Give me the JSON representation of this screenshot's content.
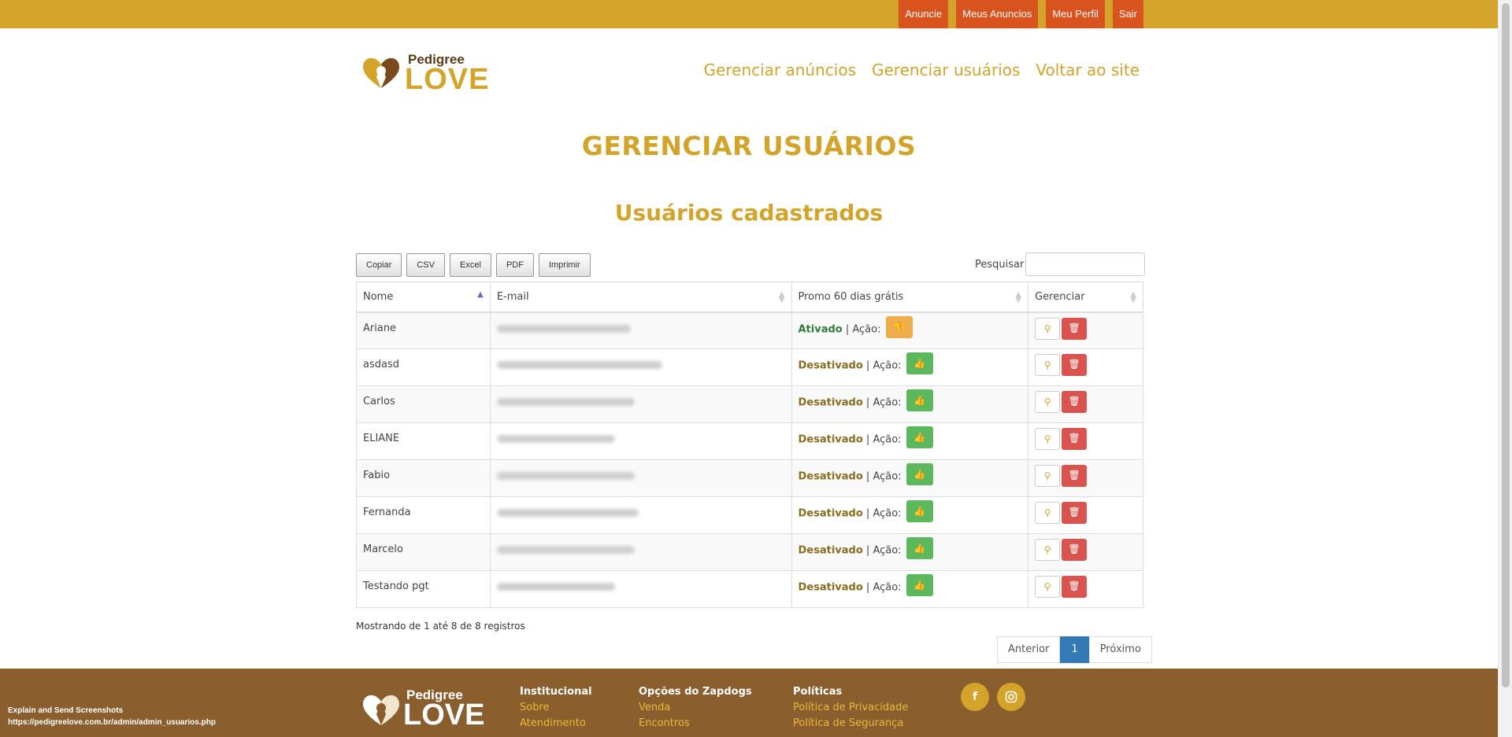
{
  "topnav": [
    "Anuncie",
    "Meus Anuncios",
    "Meu Perfil",
    "Sair"
  ],
  "logo": {
    "line1": "Pedigree",
    "line2": "LOVE"
  },
  "header_links": [
    "Gerenciar anúncios",
    "Gerenciar usuários",
    "Voltar ao site"
  ],
  "page_title": "GERENCIAR USUÁRIOS",
  "section_title": "Usuários cadastrados",
  "export_buttons": [
    "Copiar",
    "CSV",
    "Excel",
    "PDF",
    "Imprimir"
  ],
  "search": {
    "label": "Pesquisar",
    "value": ""
  },
  "table": {
    "columns": [
      "Nome",
      "E-mail",
      "Promo 60 dias grátis",
      "Gerenciar"
    ],
    "action_label": "Ação:",
    "rows": [
      {
        "name": "Ariane",
        "status": "Ativado"
      },
      {
        "name": "asdasd",
        "status": "Desativado"
      },
      {
        "name": "Carlos",
        "status": "Desativado"
      },
      {
        "name": "ELIANE",
        "status": "Desativado"
      },
      {
        "name": "Fabio",
        "status": "Desativado"
      },
      {
        "name": "Fernanda",
        "status": "Desativado"
      },
      {
        "name": "Marcelo",
        "status": "Desativado"
      },
      {
        "name": "Testando pgt",
        "status": "Desativado"
      }
    ]
  },
  "info": "Mostrando de 1 até 8 de 8 registros",
  "pagination": {
    "prev": "Anterior",
    "current": "1",
    "next": "Próximo"
  },
  "footer": {
    "columns": [
      {
        "title": "Institucional",
        "links": [
          "Sobre",
          "Atendimento"
        ]
      },
      {
        "title": "Opções do Zapdogs",
        "links": [
          "Venda",
          "Encontros"
        ]
      },
      {
        "title": "Políticas",
        "links": [
          "Política de Privacidade",
          "Política de Segurança"
        ]
      }
    ],
    "social": [
      "facebook-icon",
      "instagram-icon"
    ]
  },
  "overlay": {
    "line1": "Explain and Send Screenshots",
    "line2": "https://pedigreelove.com.br/admin/admin_usuarios.php"
  },
  "colors": {
    "brand": "#d4a32a",
    "top_button": "#d9531e",
    "footer": "#8b5e2e"
  }
}
